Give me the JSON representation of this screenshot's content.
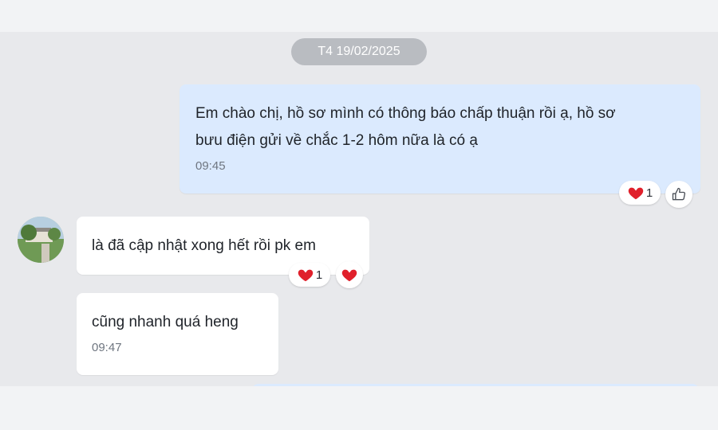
{
  "date_separator": "T4 19/02/2025",
  "messages": [
    {
      "line1": "Em chào chị, hồ sơ mình có thông báo chấp thuận rồi ạ, hồ sơ",
      "line2": "bưu điện gửi về chắc 1-2 hôm nữa là có ạ",
      "time": "09:45",
      "reaction": {
        "icon": "heart-icon",
        "count": "1"
      }
    },
    {
      "text": "là đã cập nhật xong hết rồi pk em",
      "reaction": {
        "icon": "heart-icon",
        "count": "1"
      }
    },
    {
      "text": "cũng nhanh quá heng",
      "time": "09:47"
    }
  ],
  "colors": {
    "sent_bubble": "#dbeafe",
    "received_bubble": "#ffffff",
    "chat_background": "#e8e9ec",
    "heart": "#e0202b"
  }
}
